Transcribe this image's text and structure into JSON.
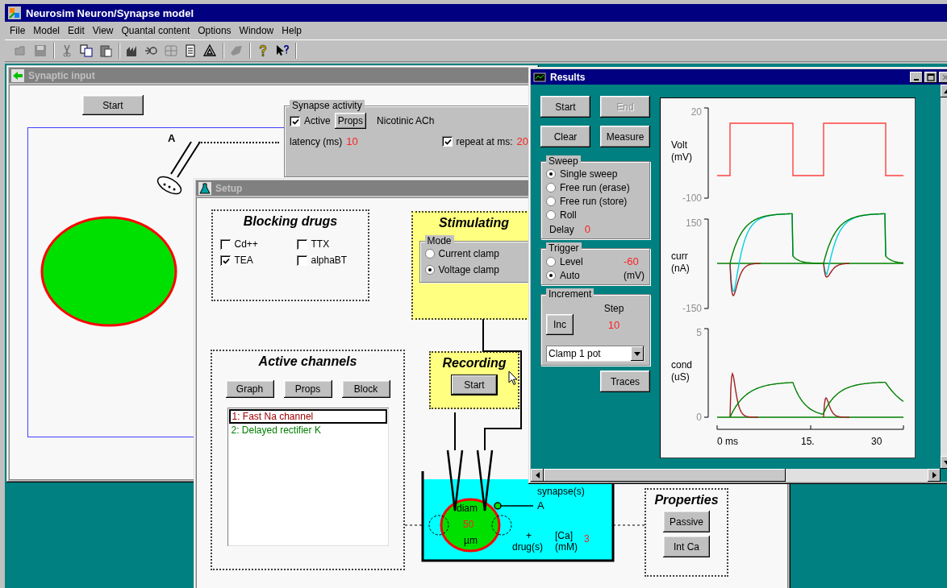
{
  "app": {
    "title": "Neurosim Neuron/Synapse model"
  },
  "menu": [
    "File",
    "Model",
    "Edit",
    "View",
    "Quantal content",
    "Options",
    "Window",
    "Help"
  ],
  "toolbar": [
    [
      {
        "kind": "open"
      },
      {
        "kind": "save"
      }
    ],
    [
      {
        "kind": "cut"
      },
      {
        "kind": "copy"
      },
      {
        "kind": "paste"
      }
    ],
    [
      {
        "kind": "model"
      },
      {
        "kind": "neuron"
      },
      {
        "kind": "grid"
      },
      {
        "kind": "notes"
      },
      {
        "kind": "triangle"
      }
    ],
    [
      {
        "kind": "shape"
      }
    ],
    [
      {
        "kind": "help"
      },
      {
        "kind": "context_help"
      }
    ]
  ],
  "synaptic_input": {
    "title": "Synaptic input",
    "active": false,
    "start_button": "Start",
    "synapse_label": "A",
    "synapse_activity": {
      "title": "Synapse activity",
      "active": {
        "label": "Active",
        "checked": true
      },
      "props_button": "Props",
      "transmitter": "Nicotinic ACh",
      "latency_label": "latency (ms)",
      "latency": "10",
      "repeat": {
        "label": "repeat at ms:",
        "checked": true
      },
      "repeat_value": "20"
    }
  },
  "setup": {
    "title": "Setup",
    "active": false,
    "blocking_drugs": {
      "title": "Blocking drugs",
      "drugs": [
        {
          "label": "Cd++",
          "checked": false
        },
        {
          "label": "TTX",
          "checked": false
        },
        {
          "label": "TEA",
          "checked": true
        },
        {
          "label": "alphaBT",
          "checked": false
        }
      ]
    },
    "stimulating": {
      "title": "Stimulating",
      "mode_title": "Mode",
      "modes": [
        {
          "label": "Current clamp",
          "selected": false
        },
        {
          "label": "Voltage clamp",
          "selected": true
        }
      ]
    },
    "active_channels": {
      "title": "Active channels",
      "buttons": [
        "Graph",
        "Props",
        "Block"
      ],
      "channels": [
        {
          "label": "1: Fast Na channel",
          "selected": true,
          "color": "#a00000"
        },
        {
          "label": "2: Delayed rectifier K",
          "selected": false,
          "color": "#008000"
        }
      ]
    },
    "recording": {
      "title": "Recording",
      "start_button": "Start"
    },
    "bath": {
      "diam_label": "diam",
      "diam": "50",
      "diam_unit": "µm",
      "synapse_label": "synapse(s)",
      "synapse": "A",
      "drug_plus": "+",
      "drug_label": "drug(s)",
      "ca_label": "[Ca]",
      "ca_unit": "(mM)",
      "ca": "3"
    },
    "properties": {
      "title": "Properties",
      "buttons": [
        "Passive",
        "Int Ca"
      ]
    }
  },
  "results": {
    "title": "Results",
    "active": true,
    "buttons": [
      {
        "label": "Start",
        "disabled": false
      },
      {
        "label": "End",
        "disabled": true
      },
      {
        "label": "Clear",
        "disabled": false
      },
      {
        "label": "Measure",
        "disabled": false
      }
    ],
    "sweep": {
      "title": "Sweep",
      "options": [
        {
          "label": "Single sweep",
          "selected": true
        },
        {
          "label": "Free run (erase)",
          "selected": false
        },
        {
          "label": "Free run (store)",
          "selected": false
        },
        {
          "label": "Roll",
          "selected": false
        }
      ],
      "delay_label": "Delay",
      "delay": "0"
    },
    "trigger": {
      "title": "Trigger",
      "options": [
        {
          "label": "Level",
          "selected": false
        },
        {
          "label": "Auto",
          "selected": true
        }
      ],
      "level": "-60",
      "unit": "(mV)"
    },
    "increment": {
      "title": "Increment",
      "step_label": "Step",
      "inc_button": "Inc",
      "step": "10",
      "target": "Clamp 1 pot"
    },
    "traces_button": "Traces",
    "plots": [
      {
        "kind": "voltage",
        "name": "Volt",
        "unit": "(mV)",
        "max": "20",
        "min": "-100"
      },
      {
        "kind": "current",
        "name": "curr",
        "unit": "(nA)",
        "max": "150",
        "min": "-150"
      },
      {
        "kind": "conductance",
        "name": "cond",
        "unit": "(uS)",
        "max": "5",
        "min": "0"
      }
    ],
    "x_ticks": [
      "0 ms",
      "15.",
      "30"
    ]
  }
}
